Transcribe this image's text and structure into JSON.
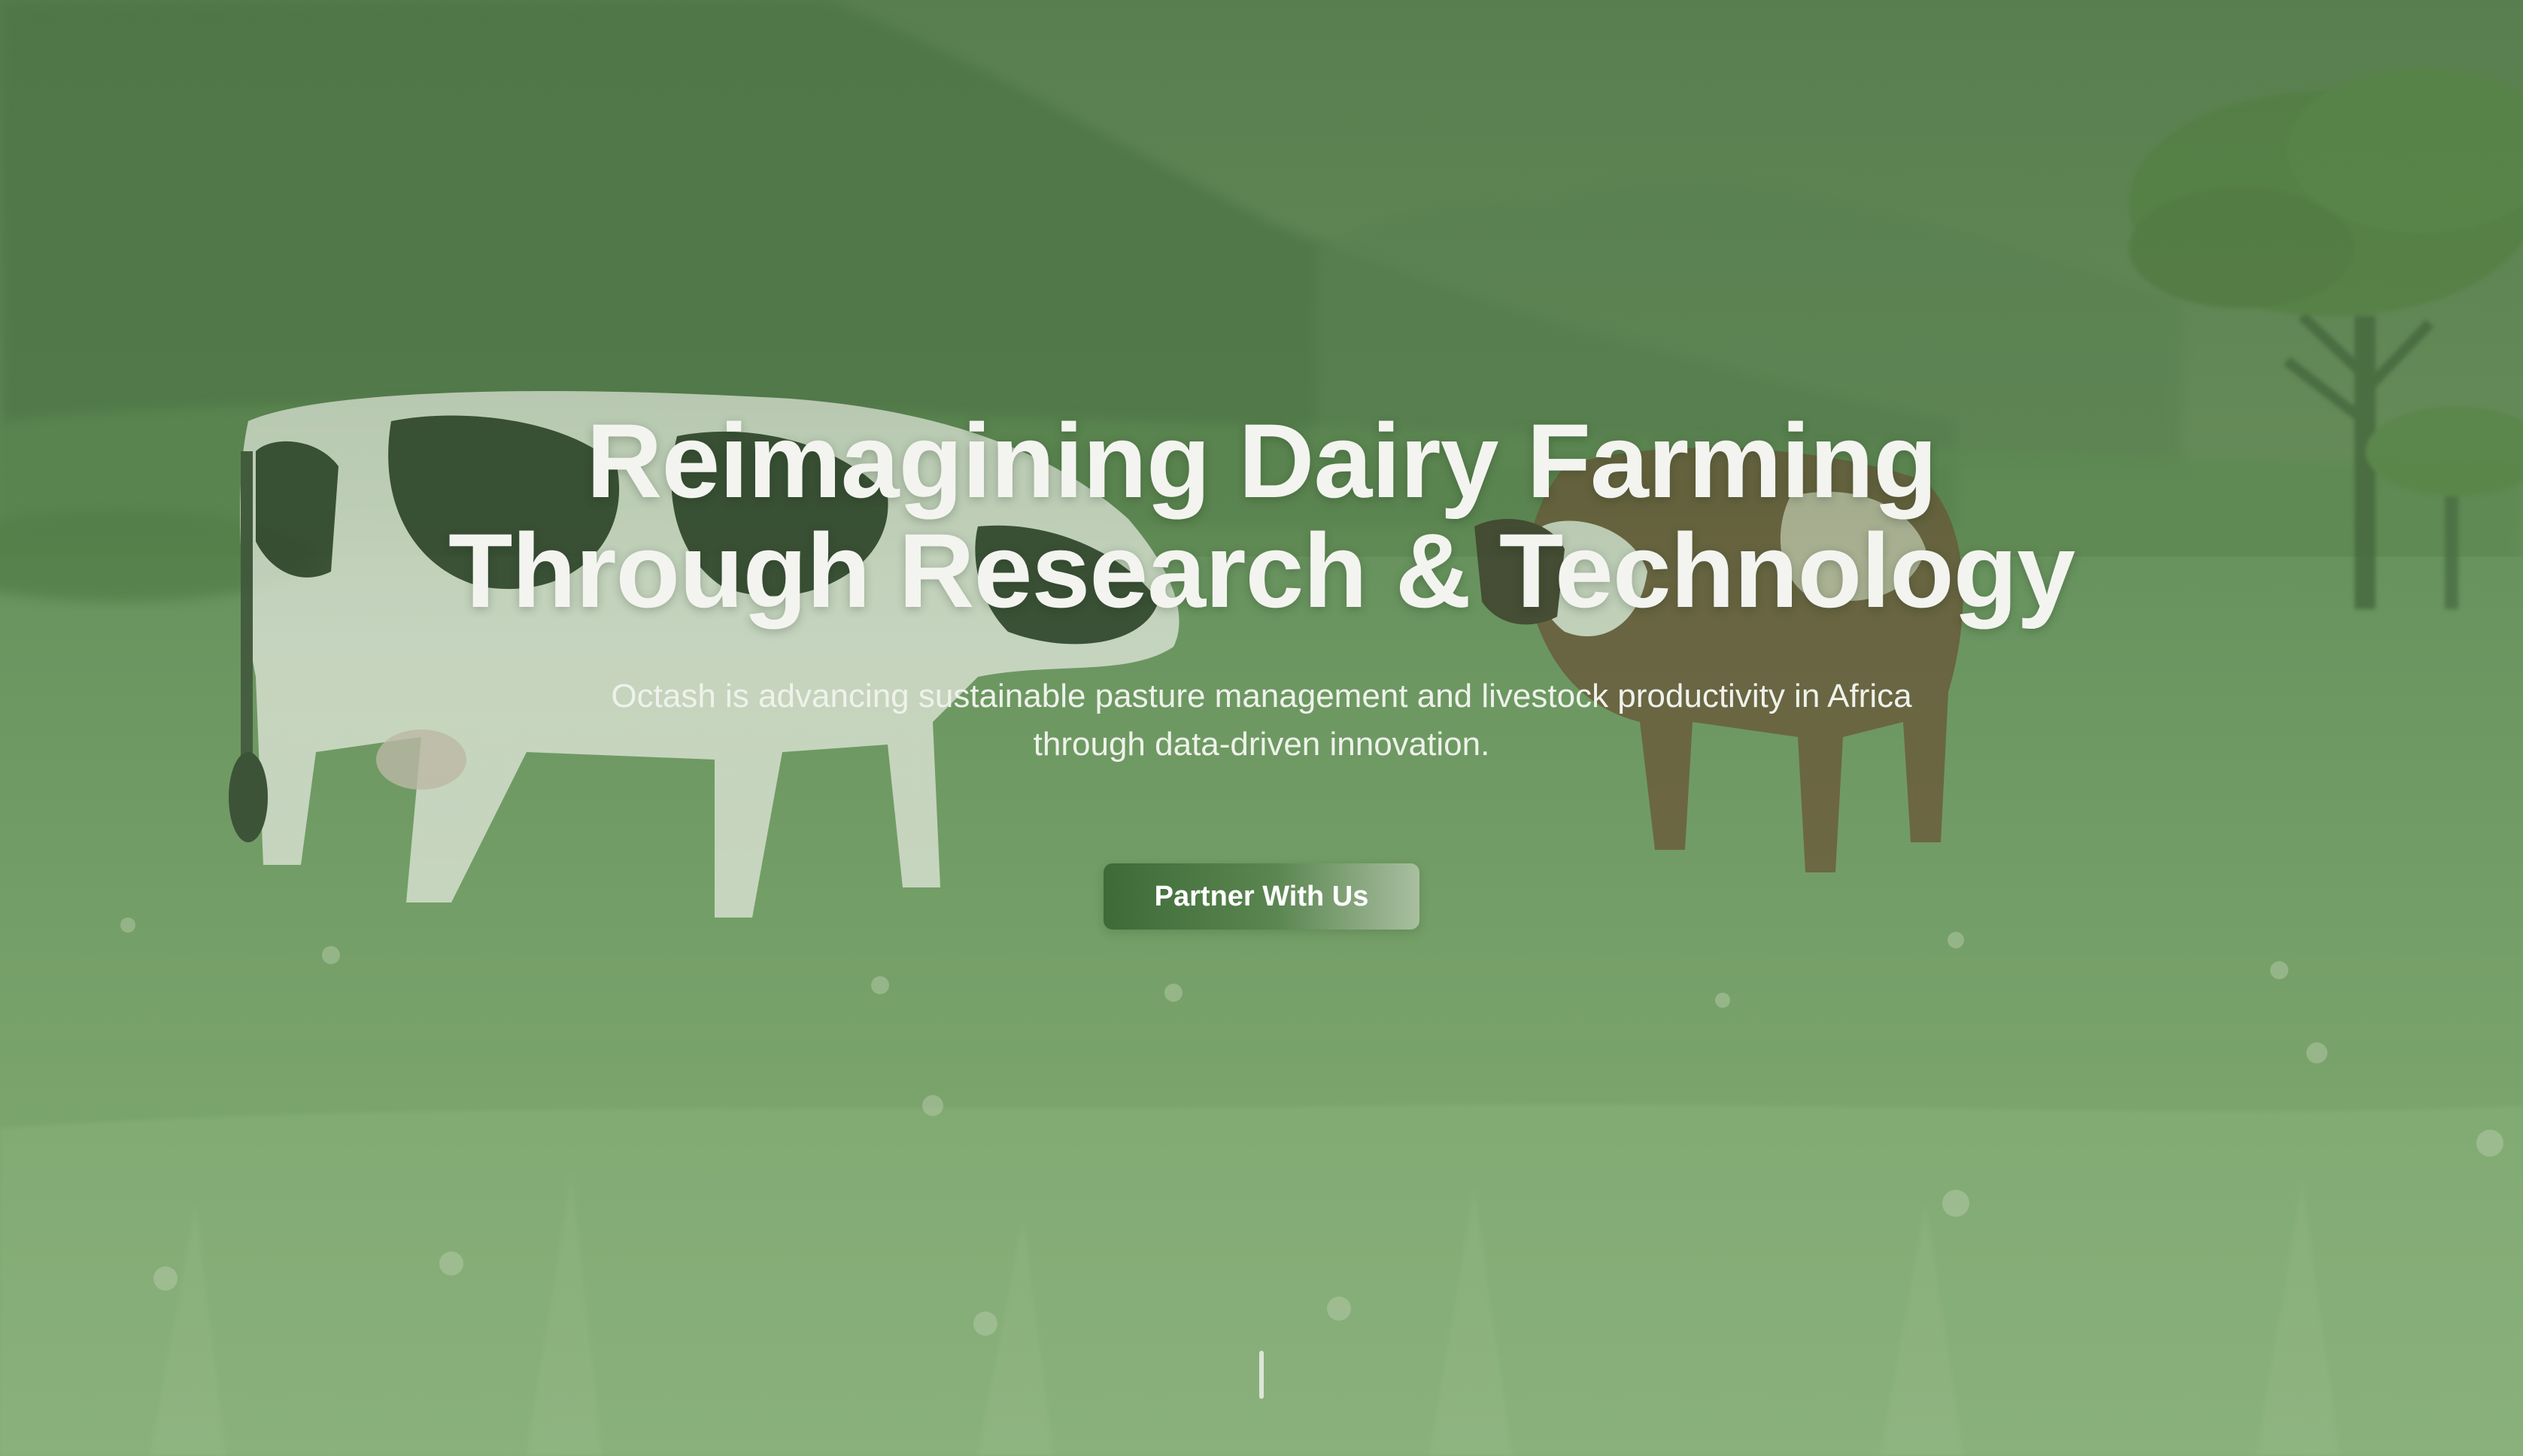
{
  "hero": {
    "title_line1": "Reimagining Dairy Farming",
    "title_line2": "Through Research & Technology",
    "subtitle": "Octash is advancing sustainable pasture management and livestock productivity in Africa through data-driven innovation.",
    "cta_label": "Partner With Us",
    "scroll_indicator": "scroll-indicator-icon"
  },
  "colors": {
    "title_text": "#f3f4ef",
    "cta_start": "#3d6a37",
    "cta_end": "#a9bfa0",
    "background_green": "#6f9461"
  }
}
